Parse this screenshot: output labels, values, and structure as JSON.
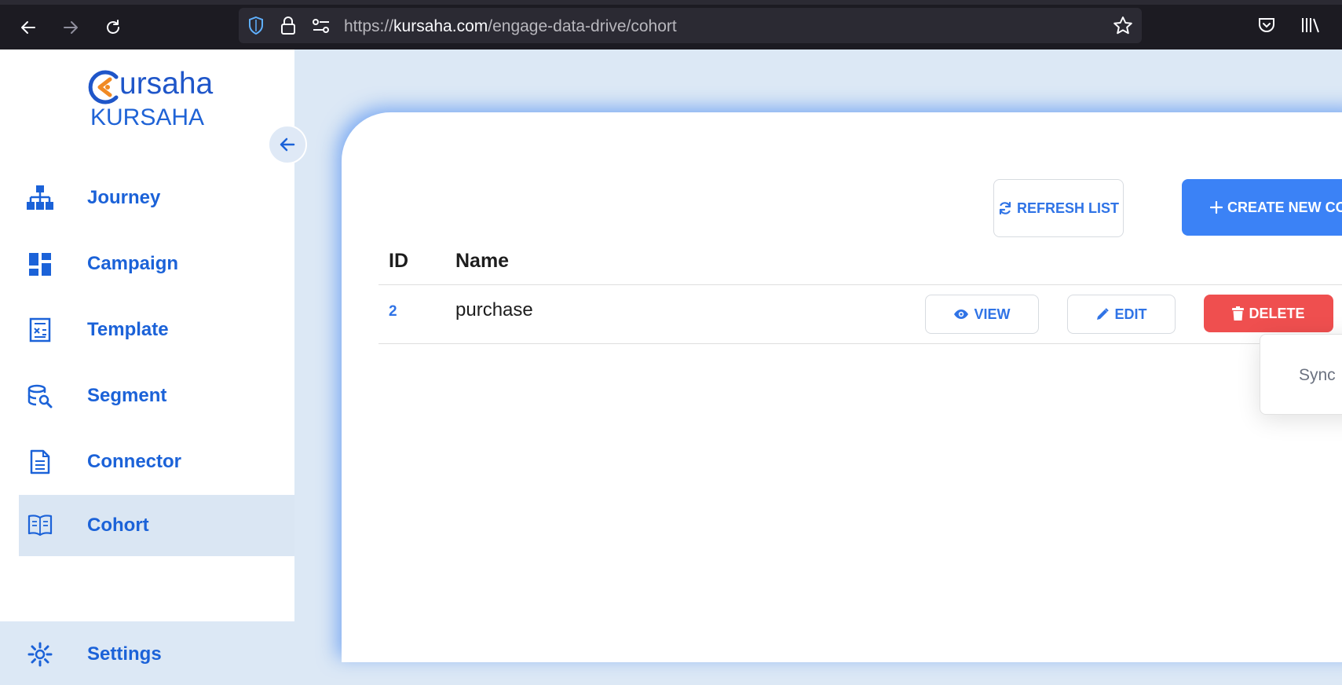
{
  "browser": {
    "url_prefix": "https://",
    "url_host": "kursaha.com",
    "url_path": "/engage-data-drive/cohort",
    "icons": [
      "back-icon",
      "forward-icon",
      "reload-icon",
      "shield-icon",
      "lock-icon",
      "permissions-icon",
      "bookmark-star-icon",
      "pocket-icon",
      "library-icon"
    ]
  },
  "logo": {
    "wordmark": "ursaha",
    "sub": "KURSAHA"
  },
  "sidebar": {
    "items": [
      {
        "label": "Journey",
        "icon": "sitemap-icon"
      },
      {
        "label": "Campaign",
        "icon": "dashboard-icon"
      },
      {
        "label": "Template",
        "icon": "template-icon"
      },
      {
        "label": "Segment",
        "icon": "database-search-icon"
      },
      {
        "label": "Connector",
        "icon": "document-icon"
      },
      {
        "label": "Cohort",
        "icon": "book-icon",
        "active": true
      },
      {
        "label": "Settings",
        "icon": "gear-icon"
      }
    ]
  },
  "toolbar": {
    "refresh_label": "REFRESH LIST",
    "create_label": "CREATE NEW CO"
  },
  "table": {
    "headers": [
      "ID",
      "Name"
    ],
    "rows": [
      {
        "id": "2",
        "name": "purchase"
      }
    ],
    "actions": {
      "view": "VIEW",
      "edit": "EDIT",
      "delete": "DELETE"
    }
  },
  "popover": {
    "text": "Sync"
  },
  "colors": {
    "accent": "#1b62d8",
    "primary": "#3b82f6",
    "danger": "#ef4f4f",
    "active_bg": "#dae6f3",
    "page_bg": "#dce8f5"
  }
}
